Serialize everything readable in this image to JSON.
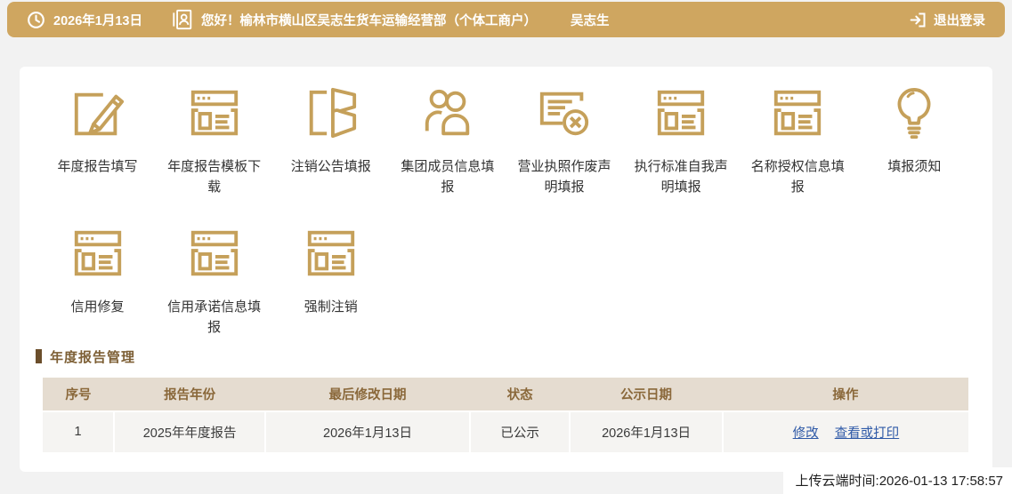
{
  "topbar": {
    "date": "2026年1月13日",
    "greeting": "您好！榆林市横山区吴志生货车运输经营部（个体工商户）",
    "username": "吴志生",
    "logout_label": "退出登录"
  },
  "menu": {
    "row1": [
      {
        "label": "年度报告填写",
        "icon": "edit-icon"
      },
      {
        "label": "年度报告模板下载",
        "icon": "template-download-icon"
      },
      {
        "label": "注销公告填报",
        "icon": "cancellation-notice-icon"
      },
      {
        "label": "集团成员信息填报",
        "icon": "group-members-icon"
      },
      {
        "label": "营业执照作废声明填报",
        "icon": "license-void-icon"
      },
      {
        "label": "执行标准自我声明填报",
        "icon": "standards-declaration-icon"
      },
      {
        "label": "名称授权信息填报",
        "icon": "name-authorization-icon"
      },
      {
        "label": "填报须知",
        "icon": "lightbulb-icon"
      }
    ],
    "row2": [
      {
        "label": "信用修复",
        "icon": "credit-repair-icon"
      },
      {
        "label": "信用承诺信息填报",
        "icon": "credit-commitment-icon"
      },
      {
        "label": "强制注销",
        "icon": "forced-cancellation-icon"
      }
    ]
  },
  "report_section": {
    "title": "年度报告管理",
    "table": {
      "headers": [
        "序号",
        "报告年份",
        "最后修改日期",
        "状态",
        "公示日期",
        "操作"
      ],
      "rows": [
        {
          "seq": "1",
          "year": "2025年年度报告",
          "modified": "2026年1月13日",
          "status": "已公示",
          "publish_date": "2026年1月13日",
          "actions": [
            "修改",
            "查看或打印"
          ]
        }
      ]
    }
  },
  "footer": {
    "upload_time": "上传云端时间:2026-01-13 17:58:57"
  },
  "colors": {
    "topbar_bg": "#cfa660",
    "icon_gold": "#c5a05a",
    "table_header_bg": "#e5dcd0",
    "table_header_text": "#8a683a",
    "section_bar": "#6b4e2b",
    "link_blue": "#2e59a7"
  }
}
